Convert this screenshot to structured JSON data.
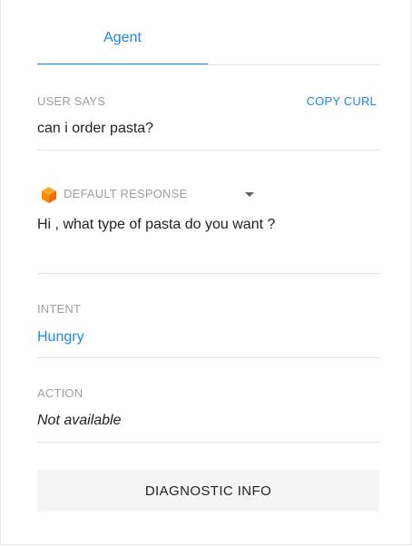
{
  "tabs": [
    {
      "label": "Agent",
      "active": true
    }
  ],
  "user_says": {
    "label": "USER SAYS",
    "copy_curl_label": "COPY CURL",
    "value": "can i order pasta?"
  },
  "default_response": {
    "icon": "dialogflow-cube-icon",
    "label": "DEFAULT RESPONSE",
    "value": "Hi , what type of pasta do you want ?"
  },
  "intent": {
    "label": "INTENT",
    "value": "Hungry"
  },
  "action": {
    "label": "ACTION",
    "value": "Not available"
  },
  "diagnostic_button": {
    "label": "DIAGNOSTIC INFO"
  },
  "colors": {
    "accent": "#1e88e5",
    "muted_label": "#9e9e9e",
    "divider": "#e0e0e0",
    "icon_orange": "#ef6c00",
    "button_bg": "#f5f5f5"
  }
}
